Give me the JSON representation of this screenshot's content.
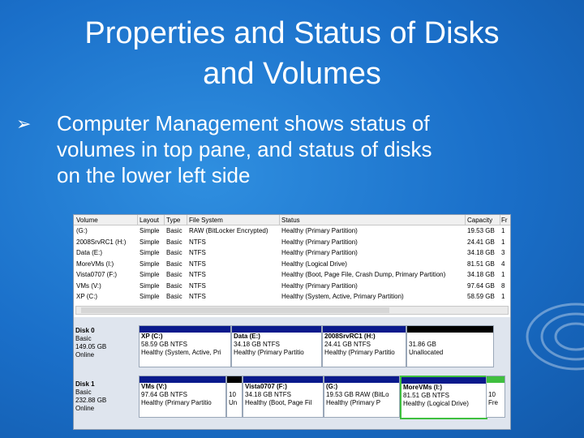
{
  "slide": {
    "title_line1": "Properties and Status of Disks",
    "title_line2": "and Volumes",
    "bullet_lines": [
      "Computer Management shows status of",
      "volumes in top pane, and status of disks",
      "on the lower left side"
    ]
  },
  "volume_list": {
    "headers": [
      "Volume",
      "Layout",
      "Type",
      "File System",
      "Status",
      "Capacity",
      "Fr"
    ],
    "rows": [
      [
        "(G:)",
        "Simple",
        "Basic",
        "RAW (BitLocker Encrypted)",
        "Healthy (Primary Partition)",
        "19.53 GB",
        "1"
      ],
      [
        "2008SrvRC1 (H:)",
        "Simple",
        "Basic",
        "NTFS",
        "Healthy (Primary Partition)",
        "24.41 GB",
        "1"
      ],
      [
        "Data (E:)",
        "Simple",
        "Basic",
        "NTFS",
        "Healthy (Primary Partition)",
        "34.18 GB",
        "3"
      ],
      [
        "MoreVMs (I:)",
        "Simple",
        "Basic",
        "NTFS",
        "Healthy (Logical Drive)",
        "81.51 GB",
        "4"
      ],
      [
        "Vista0707 (F:)",
        "Simple",
        "Basic",
        "NTFS",
        "Healthy (Boot, Page File, Crash Dump, Primary Partition)",
        "34.18 GB",
        "1"
      ],
      [
        "VMs (V:)",
        "Simple",
        "Basic",
        "NTFS",
        "Healthy (Primary Partition)",
        "97.64 GB",
        "8"
      ],
      [
        "XP (C:)",
        "Simple",
        "Basic",
        "NTFS",
        "Healthy (System, Active, Primary Partition)",
        "58.59 GB",
        "1"
      ]
    ]
  },
  "disks": [
    {
      "label": [
        "Disk 0",
        "Basic",
        "149.05 GB",
        "Online"
      ],
      "partitions": [
        {
          "name": "XP  (C:)",
          "size": "58.59 GB NTFS",
          "status": "Healthy (System, Active, Pri",
          "bar": "#0a1a8c"
        },
        {
          "name": "Data  (E:)",
          "size": "34.18 GB NTFS",
          "status": "Healthy (Primary Partitio",
          "bar": "#0a1a8c"
        },
        {
          "name": "2008SrvRC1  (H:)",
          "size": "24.41 GB NTFS",
          "status": "Healthy (Primary Partitio",
          "bar": "#0a1a8c"
        },
        {
          "name": "",
          "size": "31.86 GB",
          "status": "Unallocated",
          "bar": "#000000"
        }
      ]
    },
    {
      "label": [
        "Disk 1",
        "Basic",
        "232.88 GB",
        "Online"
      ],
      "partitions": [
        {
          "name": "VMs  (V:)",
          "size": "97.64 GB NTFS",
          "status": "Healthy (Primary Partitio",
          "bar": "#0a1a8c"
        },
        {
          "name": "",
          "size": "10",
          "status": "Un",
          "bar": "#000000"
        },
        {
          "name": "Vista0707  (F:)",
          "size": "34.18 GB NTFS",
          "status": "Healthy (Boot, Page Fil",
          "bar": "#0a1a8c"
        },
        {
          "name": "(G:)",
          "size": "19.53 GB RAW (BitLo",
          "status": "Healthy (Primary P",
          "bar": "#0a1a8c"
        },
        {
          "name": "MoreVMs  (I:)",
          "size": "81.51 GB NTFS",
          "status": "Healthy (Logical Drive)",
          "bar": "#0a1a8c"
        },
        {
          "name": "",
          "size": "10",
          "status": "Fre",
          "bar": "#3fbf3f"
        }
      ]
    }
  ]
}
